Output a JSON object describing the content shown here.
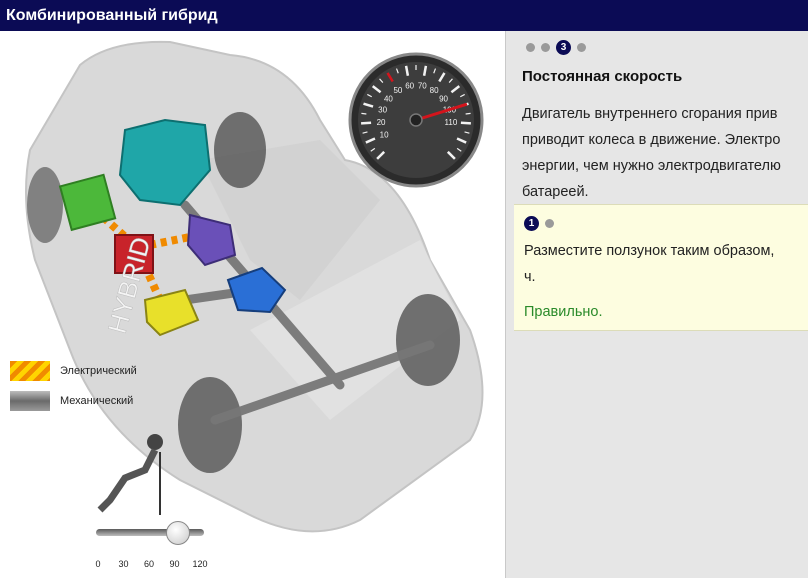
{
  "window": {
    "title": "Комбинированный гибрид"
  },
  "stepper": {
    "steps": [
      "",
      "",
      "3",
      ""
    ],
    "active": 2
  },
  "panel": {
    "heading": "Постоянная скорость",
    "desc_line1": "Двигатель внутреннего сгорания прив",
    "desc_line2": "приводит колеса в движение. Электро",
    "desc_line3": "энергии, чем нужно электродвигателю",
    "desc_line4": "батареей."
  },
  "task": {
    "step_label": "1",
    "line1": "Разместите ползунок таким образом,",
    "line2": "ч.",
    "result": "Правильно."
  },
  "legend": {
    "electric": "Электрический",
    "mechanical": "Механический"
  },
  "car": {
    "badge": "HYBRID"
  },
  "speedometer": {
    "labels": [
      "10",
      "20",
      "30",
      "40",
      "50",
      "60",
      "70",
      "80",
      "90",
      "100",
      "110"
    ],
    "value": 100
  },
  "slider": {
    "ticks": [
      "0",
      "30",
      "60",
      "90",
      "120"
    ],
    "value": 90
  }
}
